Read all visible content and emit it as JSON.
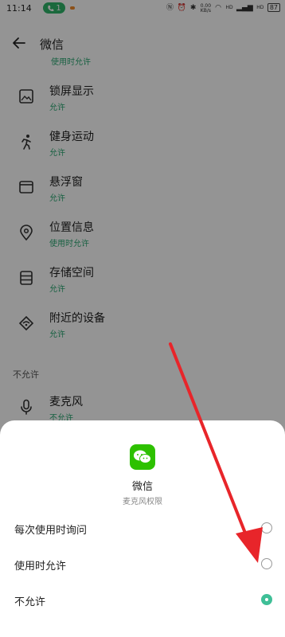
{
  "status_bar": {
    "time": "11:14",
    "call_count": "1",
    "network_speed": "0.00\nKB/s",
    "signal_1": "HD",
    "signal_2": "HD",
    "battery": "87",
    "colors": {
      "call_pill": "#2fb56a"
    }
  },
  "header": {
    "back_icon": "arrow-left-icon",
    "title": "微信"
  },
  "permissions": {
    "partial_top_sub": "使用时允许",
    "items": [
      {
        "icon": "image-icon",
        "title": "锁屏显示",
        "status": "允许"
      },
      {
        "icon": "running-icon",
        "title": "健身运动",
        "status": "允许"
      },
      {
        "icon": "window-icon",
        "title": "悬浮窗",
        "status": "允许"
      },
      {
        "icon": "location-icon",
        "title": "位置信息",
        "status": "使用时允许"
      },
      {
        "icon": "storage-icon",
        "title": "存储空间",
        "status": "允许"
      },
      {
        "icon": "nearby-devices-icon",
        "title": "附近的设备",
        "status": "允许"
      }
    ],
    "denied_section_label": "不允许",
    "denied_items": [
      {
        "icon": "microphone-icon",
        "title": "麦克风",
        "status": "不允许"
      }
    ]
  },
  "sheet": {
    "app_name": "微信",
    "subtitle": "麦克风权限",
    "options": [
      {
        "label": "每次使用时询问",
        "selected": false
      },
      {
        "label": "使用时允许",
        "selected": false
      },
      {
        "label": "不允许",
        "selected": true
      }
    ],
    "colors": {
      "selected_radio": "#3fbf97",
      "app_logo": "#2dc100"
    }
  }
}
